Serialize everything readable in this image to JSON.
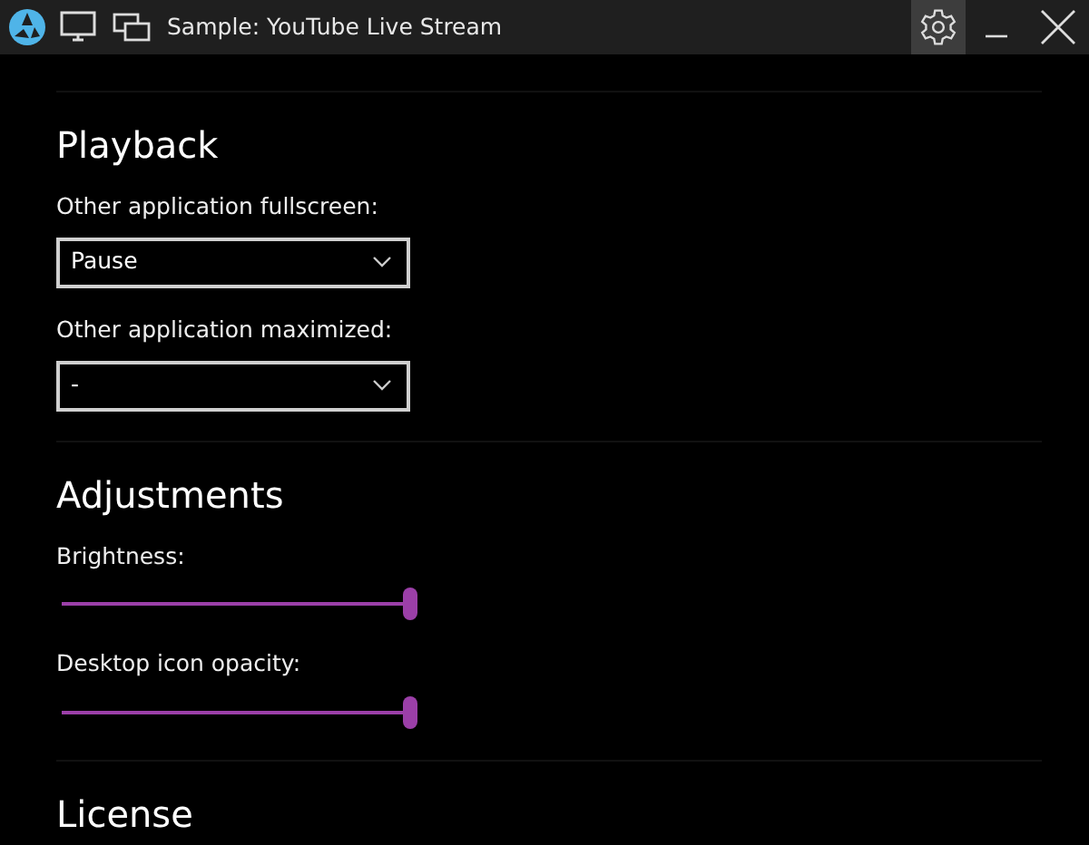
{
  "window": {
    "title": "Sample: YouTube Live Stream",
    "settings_selected": true
  },
  "sections": [
    {
      "heading": "Playback",
      "items": [
        {
          "kind": "dropdown",
          "label": "Other application fullscreen:",
          "value": "Pause"
        },
        {
          "kind": "dropdown",
          "label": "Other application maximized:",
          "value": "-"
        }
      ]
    },
    {
      "heading": "Adjustments",
      "items": [
        {
          "kind": "slider",
          "label": "Brightness:",
          "level": 1
        },
        {
          "kind": "slider",
          "label": "Desktop icon opacity:",
          "level": 1
        }
      ]
    },
    {
      "heading": "License"
    }
  ]
}
